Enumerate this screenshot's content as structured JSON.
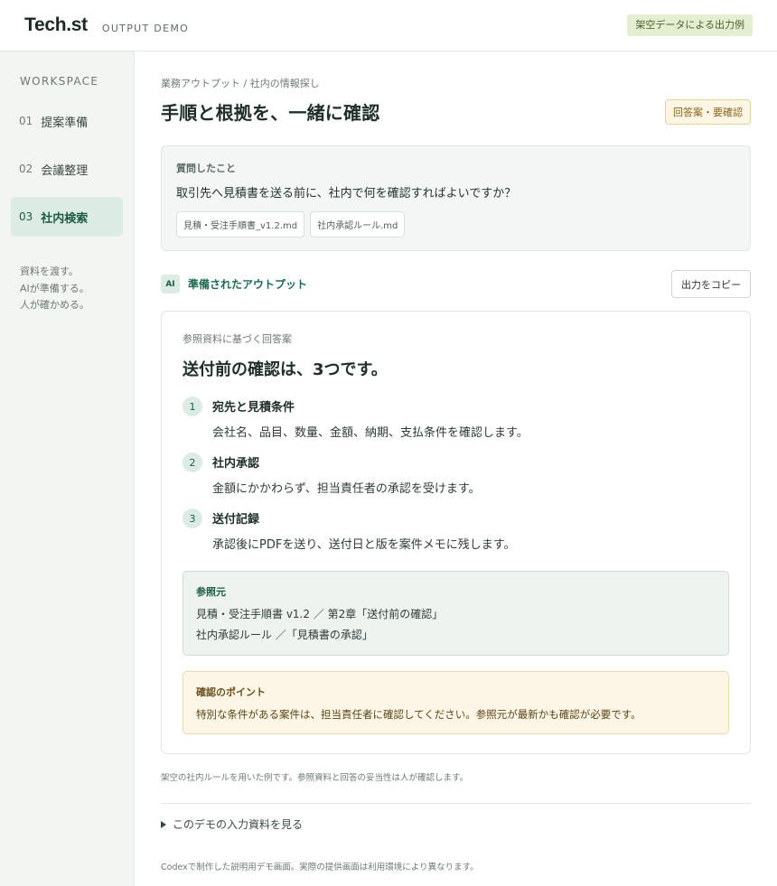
{
  "header": {
    "logo": "Tech.st",
    "subtitle": "OUTPUT DEMO",
    "badge": "架空データによる出力例"
  },
  "sidebar": {
    "heading": "WORKSPACE",
    "items": [
      {
        "num": "01",
        "label": "提案準備",
        "active": false
      },
      {
        "num": "02",
        "label": "会議整理",
        "active": false
      },
      {
        "num": "03",
        "label": "社内検索",
        "active": true
      }
    ],
    "note": [
      "資料を渡す。",
      "AIが準備する。",
      "人が確かめる。"
    ]
  },
  "main": {
    "breadcrumb": "業務アウトプット / 社内の情報探し",
    "title": "手順と根拠を、一緒に確認",
    "status_badge": "回答案・要確認",
    "question": {
      "label": "質問したこと",
      "text": "取引先へ見積書を送る前に、社内で何を確認すればよいですか？",
      "files": [
        "見積・受注手順書_v1.2.md",
        "社内承認ルール.md"
      ]
    },
    "output": {
      "ai_badge": "AI",
      "label": "準備されたアウトプット",
      "copy_button": "出力をコピー"
    },
    "answer": {
      "sub": "参照資料に基づく回答案",
      "title": "送付前の確認は、3つです。",
      "steps": [
        {
          "num": "1",
          "title": "宛先と見積条件",
          "desc": "会社名、品目、数量、金額、納期、支払条件を確認します。"
        },
        {
          "num": "2",
          "title": "社内承認",
          "desc": "金額にかかわらず、担当責任者の承認を受けます。"
        },
        {
          "num": "3",
          "title": "送付記録",
          "desc": "承認後にPDFを送り、送付日と版を案件メモに残します。"
        }
      ],
      "sources": {
        "label": "参照元",
        "lines": [
          "見積・受注手順書 v1.2 ／ 第2章「送付前の確認」",
          "社内承認ルール ／「見積書の承認」"
        ]
      },
      "check": {
        "label": "確認のポイント",
        "text": "特別な条件がある案件は、担当責任者に確認してください。参照元が最新かも確認が必要です。"
      }
    },
    "footnote": "架空の社内ルールを用いた例です。参照資料と回答の妥当性は人が確認します。",
    "details_toggle": "このデモの入力資料を見る",
    "bottom_note": "Codexで制作した説明用デモ画面。実際の提供画面は利用環境により異なります。"
  }
}
